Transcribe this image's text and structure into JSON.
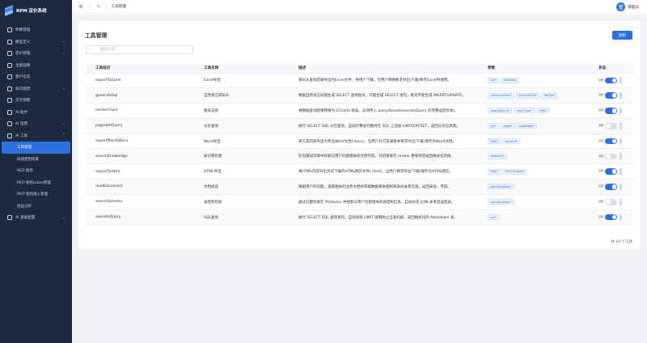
{
  "app": {
    "title": "RPM 定价系统"
  },
  "sidebar": {
    "items": [
      {
        "label": "参数管理",
        "has_children": false
      },
      {
        "label": "模型定义",
        "has_children": true
      },
      {
        "label": "定价管理",
        "has_children": true
      },
      {
        "label": "全部画像",
        "has_children": false
      },
      {
        "label": "客户信息",
        "has_children": false
      },
      {
        "label": "知识图谱",
        "has_children": true
      },
      {
        "label": "交叉销售",
        "has_children": false
      },
      {
        "label": "AI 助手",
        "has_children": false
      },
      {
        "label": "AI 运营",
        "has_children": true
      },
      {
        "label": "AI 工具",
        "has_children": true,
        "expanded": true
      }
    ],
    "subitems": [
      {
        "label": "工具管理",
        "active": true
      },
      {
        "label": "技能使用指南",
        "active": false
      },
      {
        "label": "MCP 服务",
        "active": false
      },
      {
        "label": "MCP 服务token管理",
        "active": false
      },
      {
        "label": "MCP 服务接入管理",
        "active": false
      },
      {
        "label": "收益分析",
        "active": false
      }
    ],
    "last_item": {
      "label": "AI 基础配置",
      "has_children": true
    }
  },
  "topbar": {
    "breadcrumb": "工具管理",
    "username": "管理员",
    "avatar_text": "管"
  },
  "page": {
    "title": "工具管理",
    "refresh_label": "刷新",
    "search_placeholder": "搜索工具",
    "total_text": "共 10 个工具"
  },
  "table": {
    "headers": [
      "工具标识",
      "工具名称",
      "描述",
      "参数",
      "状态"
    ],
    "status_label": "启用",
    "rows": [
      {
        "id": "exportToExcel",
        "name": "Excel导出",
        "desc": "将SQL查询结果导出为Excel文件，供用户下载。在用户明确要求导出/下载/保存Excel时调用。",
        "params": [
          "sql*",
          "fileName"
        ],
        "enabled": true
      },
      {
        "id": "generateSql",
        "name": "自然语言转SQL",
        "desc": "根据自然语言问题生成 SELECT 查询指令。只能生成 SELECT 语句，绝对不能生成 INSERT/UPDATE。",
        "params": [
          "userQuestion*",
          "schemaInfo*",
          "dbType"
        ],
        "enabled": true
      },
      {
        "id": "renderChart",
        "name": "图表渲染",
        "desc": "将数据查询结果转换为 ECharts 图表。必须传入 queryResult(executeQuery 的完整返回文本)。",
        "params": [
          "queryResult*",
          "chartType*",
          "title*"
        ],
        "enabled": true
      },
      {
        "id": "paginateQuery",
        "name": "分页查询",
        "desc": "执行 SELECT SQL 分页查询，自动计算总行数并在 SQL 上追加 LIMIT/OFFSET，返回分页信息和。",
        "params": [
          "sql*",
          "page*",
          "pageSize*"
        ],
        "enabled": false
      },
      {
        "id": "exportPlanToDocx",
        "name": "Word导出",
        "desc": "将方案内容导出为专业Word文档(.docx)。当用户对方案满意并要求导出/下载/保存为Word文档。",
        "params": [
          "title*",
          "content*"
        ],
        "enabled": true
      },
      {
        "id": "searchKnowledge",
        "name": "知识库检索",
        "desc": "在向量知识库中检索与用户问题相关的文档内容。对结果进行 rerank 重排序后返回格式化的搜。",
        "params": [
          "question*"
        ],
        "enabled": false
      },
      {
        "id": "exportToHtml",
        "name": "HTML导出",
        "desc": "将HTML内容导出为可下载的HTML网页文件(.html)。当用户要求导出/下载/保存为HTML网页。",
        "params": [
          "title*",
          "htmlContent*"
        ],
        "enabled": true
      },
      {
        "id": "readDocument",
        "name": "文档阅读",
        "desc": "根据用户的问题，读取相关的业务文档并获取数据库表结构和表间关系信息。返回表名、字段。",
        "params": [
          "userQuestion*"
        ],
        "enabled": true
      },
      {
        "id": "searchSchema",
        "name": "表结构检索",
        "desc": "通过向量检索在 PGVector 中搜索与用户问题相关的表结构信息，自动补充 JOIN 关系后返回表。",
        "params": [
          "userQuestion*"
        ],
        "enabled": false
      },
      {
        "id": "executeQuery",
        "name": "SQL查询",
        "desc": "执行 SELECT SQL 查询语句，自动添加 LIMIT 限制防止全表扫描，返回格式化的 Markdown 表。",
        "params": [
          "sql*"
        ],
        "enabled": true
      }
    ]
  },
  "colors": {
    "sidebar_bg": "#1c2b40",
    "accent": "#2f6fe0",
    "page_bg": "#f0f2f5"
  }
}
